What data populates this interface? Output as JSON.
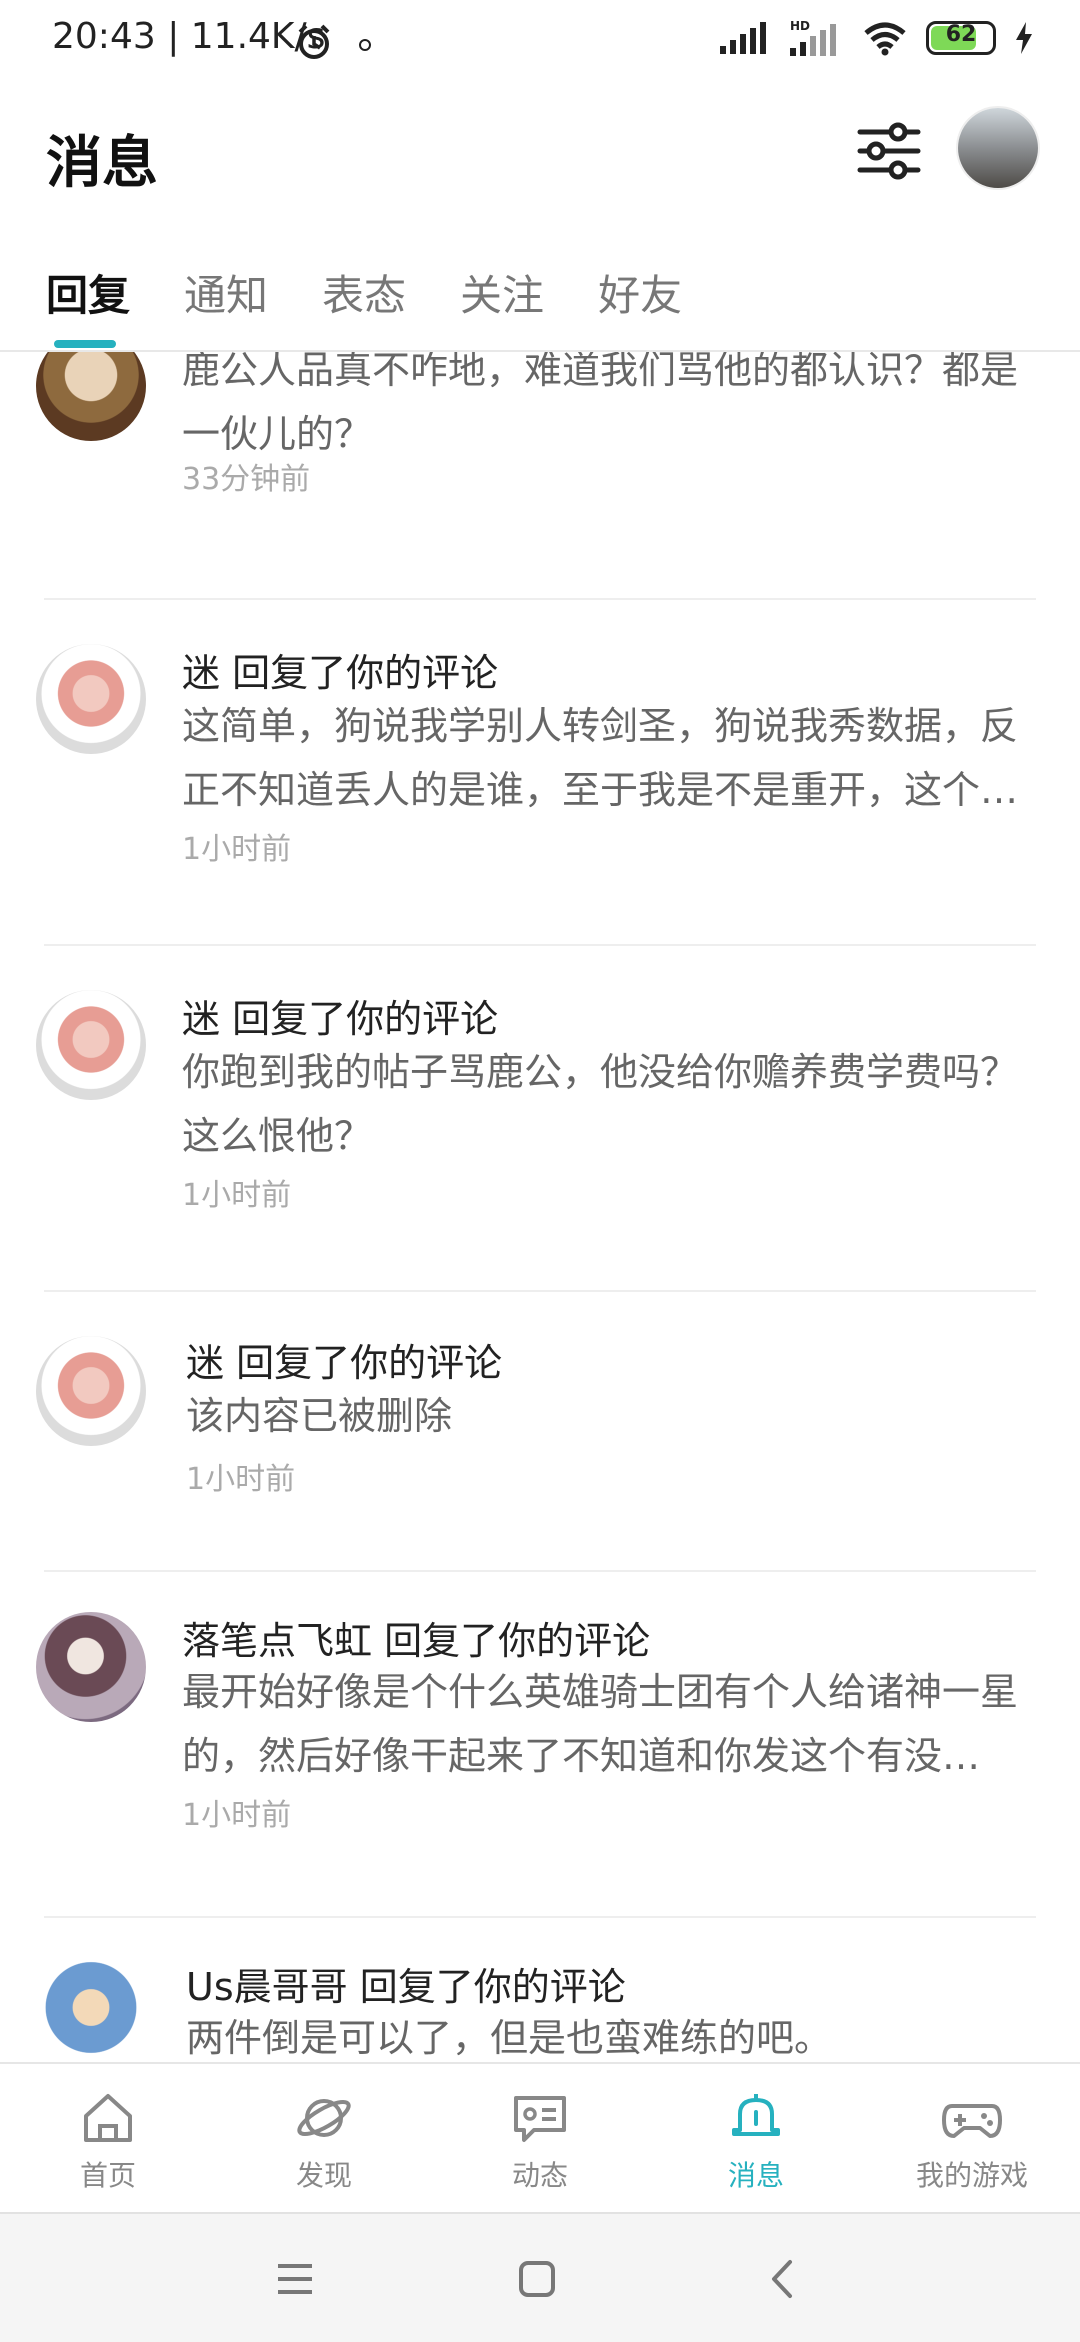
{
  "status_bar": {
    "time_speed": "20:43 | 11.4K/s",
    "battery": "62"
  },
  "header": {
    "title": "消息"
  },
  "tabs": [
    {
      "label": "回复",
      "active": true
    },
    {
      "label": "通知",
      "active": false
    },
    {
      "label": "表态",
      "active": false
    },
    {
      "label": "关注",
      "active": false
    },
    {
      "label": "好友",
      "active": false
    }
  ],
  "messages": [
    {
      "title": "",
      "body": "鹿公人品真不咋地，难道我们骂他的都认识？都是一伙儿的？",
      "time": "33分钟前"
    },
    {
      "title": "迷 回复了你的评论",
      "body": "这简单，狗说我学别人转剑圣，狗说我秀数据，反正不知道丢人的是谁，至于我是不是重开，这个…",
      "time": "1小时前"
    },
    {
      "title": "迷 回复了你的评论",
      "body": "你跑到我的帖子骂鹿公，他没给你赡养费学费吗？这么恨他？",
      "time": "1小时前"
    },
    {
      "title": "迷 回复了你的评论",
      "body": "该内容已被删除",
      "time": "1小时前"
    },
    {
      "title": "落笔点飞虹 回复了你的评论",
      "body": "最开始好像是个什么英雄骑士团有个人给诸神一星的，然后好像干起来了不知道和你发这个有没…",
      "time": "1小时前"
    },
    {
      "title": "Us晨哥哥 回复了你的评论",
      "body": "两件倒是可以了，但是也蛮难练的吧。",
      "time": ""
    }
  ],
  "bottom_nav": [
    {
      "label": "首页",
      "icon": "home-icon"
    },
    {
      "label": "发现",
      "icon": "planet-icon"
    },
    {
      "label": "动态",
      "icon": "chat-card-icon"
    },
    {
      "label": "消息",
      "icon": "bell-icon",
      "active": true
    },
    {
      "label": "我的游戏",
      "icon": "gamepad-icon"
    }
  ],
  "colors": {
    "accent": "#26b1bf"
  }
}
